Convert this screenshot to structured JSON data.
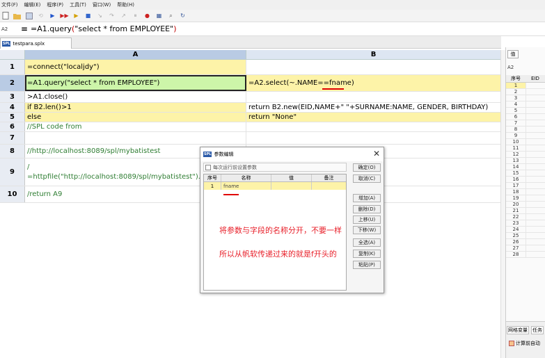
{
  "menu": [
    "文件(F)",
    "编辑(E)",
    "程序(P)",
    "工具(T)",
    "窗口(W)",
    "帮助(H)"
  ],
  "formula_bar": {
    "cell_ref": "A2",
    "equals": "=",
    "prefix": "=A1.query",
    "open_paren": "(",
    "arg": "\"select * from   EMPLOYEE\"",
    "close_paren": ")"
  },
  "file_tab": "testpara.splx",
  "columns": {
    "a": "A",
    "b": "B"
  },
  "rows": [
    {
      "num": "1",
      "a": "=connect(\"localjdy\")",
      "b": ""
    },
    {
      "num": "2",
      "a": "=A1.query(\"select * from   EMPLOYEE\")",
      "b": "=A2.select(~.NAME==fname)"
    },
    {
      "num": "3",
      "a": ">A1.close()",
      "b": ""
    },
    {
      "num": "4",
      "a": "if B2.len()>1",
      "b": "return B2.new(EID,NAME+\" \"+SURNAME:NAME,   GENDER, BIRTHDAY)"
    },
    {
      "num": "5",
      "a": "else",
      "b": "return \"None\""
    },
    {
      "num": "6",
      "a": "//SPL code from",
      "b": ""
    },
    {
      "num": "7",
      "a": "",
      "b": ""
    },
    {
      "num": "8",
      "a": "//http://localhost:8089/spl/mybatistest",
      "b": ""
    },
    {
      "num": "9",
      "a_line1": "/",
      "a_line2": "=httpfile(\"http://localhost:8089/spl/mybatistest\").import",
      "b": ""
    },
    {
      "num": "10",
      "a": "/return A9",
      "b": ""
    }
  ],
  "right_panel": {
    "tab": "值",
    "cell_ref": "A2",
    "headers": [
      "序号",
      "EID"
    ],
    "row_numbers": [
      "1",
      "2",
      "3",
      "4",
      "5",
      "6",
      "7",
      "8",
      "9",
      "10",
      "11",
      "12",
      "13",
      "14",
      "15",
      "16",
      "17",
      "18",
      "19",
      "20",
      "21",
      "22",
      "23",
      "24",
      "25",
      "26",
      "27",
      "28"
    ],
    "bottom_tabs": [
      "网格变量",
      "任务"
    ],
    "auto_calc": "计算前自动"
  },
  "dialog": {
    "title": "参数编辑",
    "checkbox": "每次运行前设置参数",
    "headers": [
      "序号",
      "名称",
      "值",
      "备注"
    ],
    "param_row": {
      "num": "1",
      "name": "fname",
      "value": "",
      "note": ""
    },
    "buttons": [
      "确定(O)",
      "取消(C)",
      "增加(A)",
      "删除(D)",
      "上移(U)",
      "下移(W)",
      "全选(A)",
      "复制(K)",
      "粘贴(P)"
    ],
    "annotation_1": "将参数与字段的名称分开，不要一样",
    "annotation_2": "所以从帆软传递过来的就是f开头的"
  },
  "colors": {
    "cell_yellow": "#fdf3a8",
    "cell_green": "#cdf5a9",
    "comment_green": "#2e7d32",
    "annotation_red": "#e8202a"
  }
}
